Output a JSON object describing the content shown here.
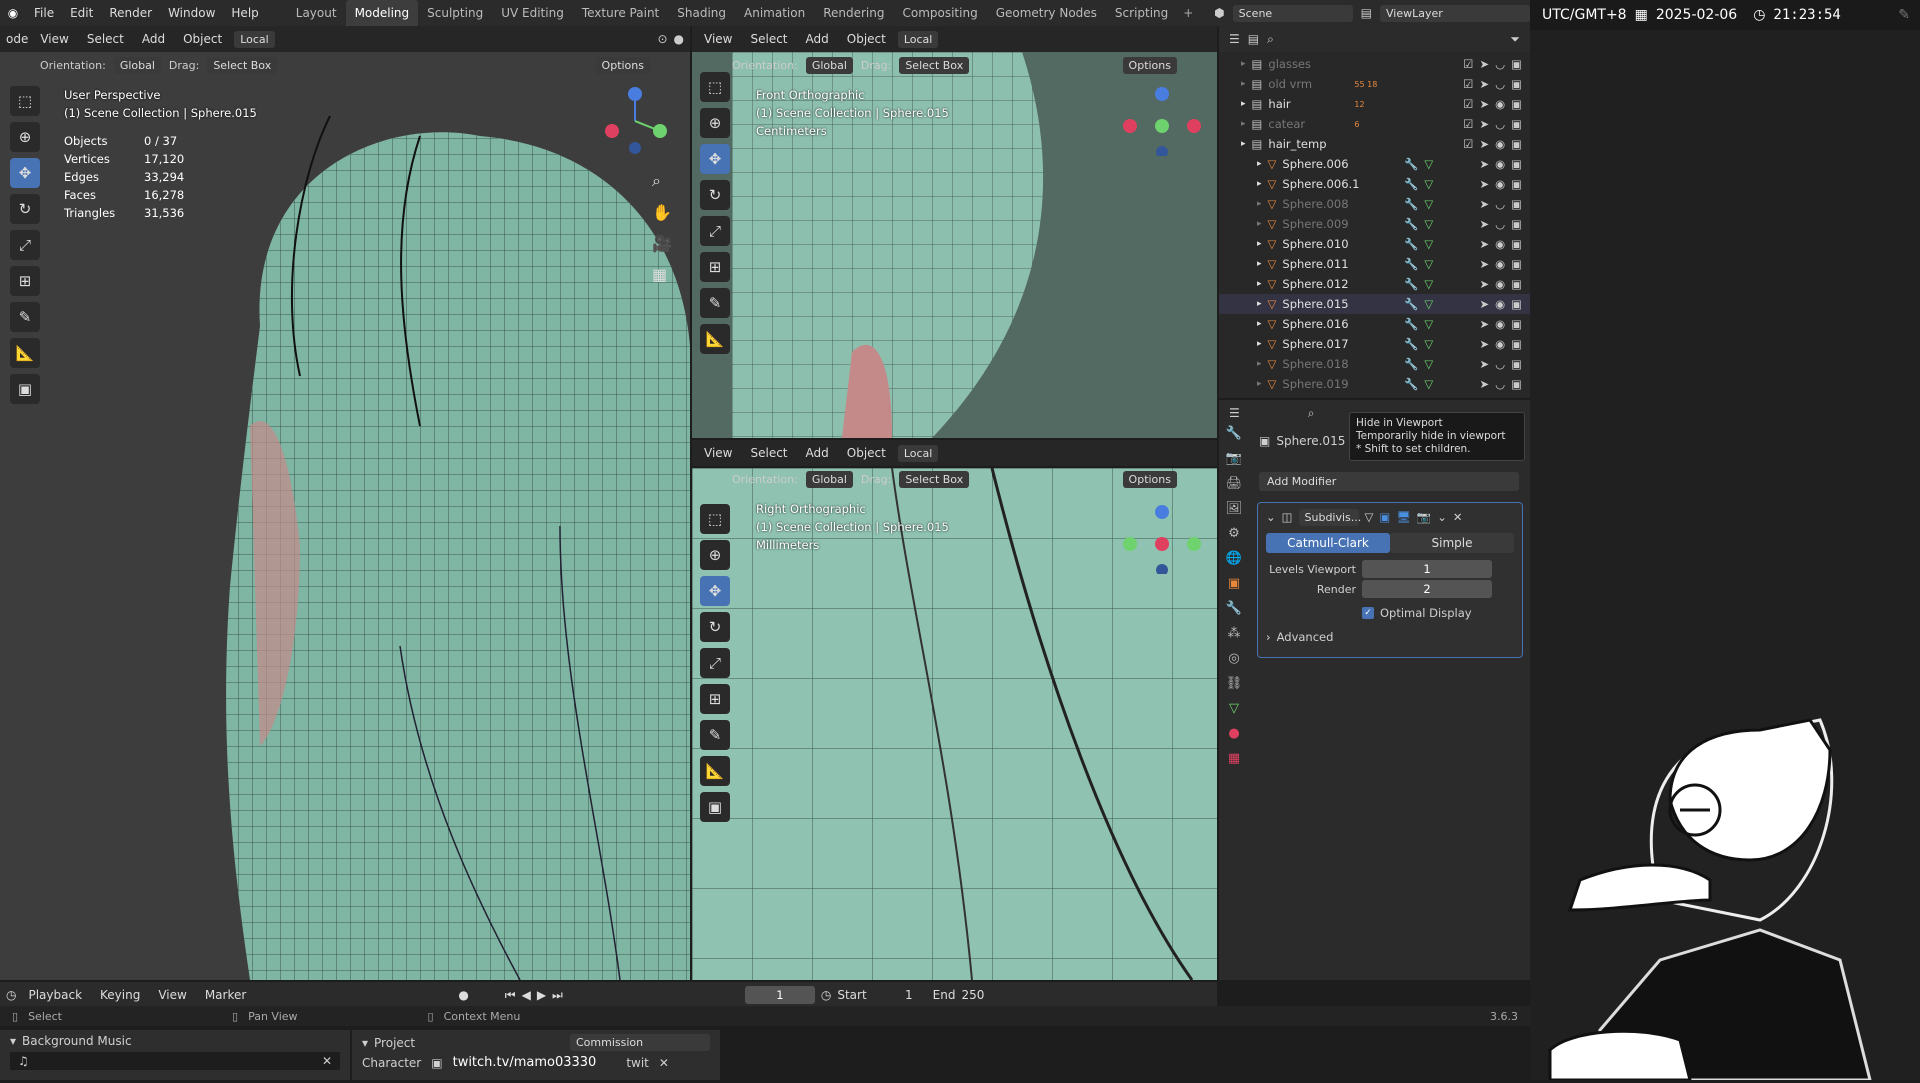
{
  "topbar": {
    "menus": [
      "File",
      "Edit",
      "Render",
      "Window",
      "Help"
    ],
    "workspaces": [
      "Layout",
      "Modeling",
      "Sculpting",
      "UV Editing",
      "Texture Paint",
      "Shading",
      "Animation",
      "Rendering",
      "Compositing",
      "Geometry Nodes",
      "Scripting"
    ],
    "active_workspace": "Modeling",
    "scene": "Scene",
    "viewlayer": "ViewLayer"
  },
  "clock": {
    "tz": "UTC/GMT+8",
    "date": "2025-02-06",
    "time": "21:23:54"
  },
  "viewport_header": {
    "mode": "ode",
    "menus": [
      "View",
      "Select",
      "Add",
      "Object"
    ],
    "transform": "Local",
    "orientation_label": "Orientation:",
    "orientation": "Global",
    "drag_label": "Drag:",
    "drag": "Select Box",
    "options": "Options"
  },
  "main_view": {
    "title": "User Perspective",
    "subtitle": "(1) Scene Collection | Sphere.015",
    "stats": [
      [
        "Objects",
        "0 / 37"
      ],
      [
        "Vertices",
        "17,120"
      ],
      [
        "Edges",
        "33,294"
      ],
      [
        "Faces",
        "16,278"
      ],
      [
        "Triangles",
        "31,536"
      ]
    ]
  },
  "front_view": {
    "title": "Front Orthographic",
    "subtitle": "(1) Scene Collection | Sphere.015",
    "units": "Centimeters"
  },
  "right_view": {
    "title": "Right Orthographic",
    "subtitle": "(1) Scene Collection | Sphere.015",
    "units": "Millimeters"
  },
  "outliner": {
    "items": [
      {
        "name": "glasses",
        "dim": true,
        "badge": ""
      },
      {
        "name": "old vrm",
        "dim": true,
        "badge": "55 18"
      },
      {
        "name": "hair",
        "dim": false,
        "badge": "12"
      },
      {
        "name": "catear",
        "dim": true,
        "badge": "6"
      },
      {
        "name": "hair_temp",
        "dim": false,
        "badge": ""
      },
      {
        "name": "Sphere.006",
        "dim": false,
        "badge": ""
      },
      {
        "name": "Sphere.006.1",
        "dim": false,
        "badge": ""
      },
      {
        "name": "Sphere.008",
        "dim": true,
        "badge": ""
      },
      {
        "name": "Sphere.009",
        "dim": true,
        "badge": ""
      },
      {
        "name": "Sphere.010",
        "dim": false,
        "badge": ""
      },
      {
        "name": "Sphere.011",
        "dim": false,
        "badge": ""
      },
      {
        "name": "Sphere.012",
        "dim": false,
        "badge": ""
      },
      {
        "name": "Sphere.015",
        "dim": false,
        "badge": ""
      },
      {
        "name": "Sphere.016",
        "dim": false,
        "badge": ""
      },
      {
        "name": "Sphere.017",
        "dim": false,
        "badge": ""
      },
      {
        "name": "Sphere.018",
        "dim": true,
        "badge": ""
      },
      {
        "name": "Sphere.019",
        "dim": true,
        "badge": ""
      }
    ]
  },
  "properties": {
    "object": "Sphere.015",
    "tooltip": {
      "title": "Hide in Viewport",
      "line1": "Temporarily hide in viewport",
      "line2": "* Shift to set children."
    },
    "add_modifier": "Add Modifier",
    "modifier": {
      "name": "Subdivis...",
      "mode_a": "Catmull-Clark",
      "mode_b": "Simple",
      "levels_label": "Levels Viewport",
      "levels": "1",
      "render_label": "Render",
      "render": "2",
      "optimal": "Optimal Display",
      "advanced": "Advanced"
    }
  },
  "timeline": {
    "menus": [
      "Playback",
      "Keying",
      "View",
      "Marker"
    ],
    "frame": "1",
    "start_label": "Start",
    "start": "1",
    "end_label": "End",
    "end": "250"
  },
  "statusbar": {
    "select": "Select",
    "pan": "Pan View",
    "context": "Context Menu",
    "version": "3.6.3"
  },
  "bottom": {
    "bg_music": "Background Music",
    "project": "Project",
    "project_value": "Commission",
    "character_label": "Character",
    "character_value": "twitch.tv/mamo03330",
    "character_suffix": "twit"
  },
  "colors": {
    "accent": "#4772b3",
    "mesh": "#7fb5a3",
    "orange": "#e8873a",
    "green": "#6ed36e"
  }
}
